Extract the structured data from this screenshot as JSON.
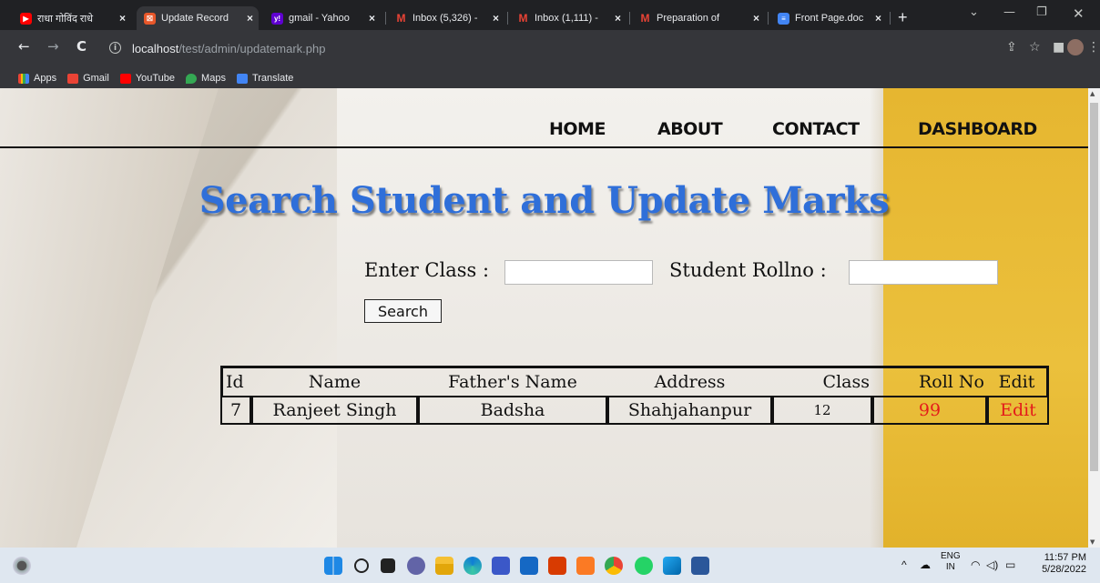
{
  "browser": {
    "tabs": [
      {
        "title": "राधा गोविंद राधे",
        "favicon_color": "#ff0000",
        "favicon": "▶",
        "active": false
      },
      {
        "title": "Update Record",
        "favicon_color": "#e8572a",
        "favicon": "☒",
        "active": true
      },
      {
        "title": "gmail - Yahoo",
        "favicon_color": "#5f01d1",
        "favicon": "y!",
        "active": false
      },
      {
        "title": "Inbox (5,326) -",
        "favicon_color": "#ea4335",
        "favicon": "M",
        "active": false
      },
      {
        "title": "Inbox (1,111) -",
        "favicon_color": "#ea4335",
        "favicon": "M",
        "active": false
      },
      {
        "title": "Preparation of",
        "favicon_color": "#ea4335",
        "favicon": "M",
        "active": false
      },
      {
        "title": "Front Page.doc",
        "favicon_color": "#4285f4",
        "favicon": "≡",
        "active": false
      }
    ],
    "url_host": "localhost",
    "url_path": "/test/admin/updatemark.php",
    "bookmarks": [
      {
        "label": "Apps",
        "color": "#4285f4"
      },
      {
        "label": "Gmail",
        "color": "#ea4335"
      },
      {
        "label": "YouTube",
        "color": "#ff0000"
      },
      {
        "label": "Maps",
        "color": "#34a853"
      },
      {
        "label": "Translate",
        "color": "#4285f4"
      }
    ]
  },
  "nav": {
    "home": "HOME",
    "about": "ABOUT",
    "contact": "CONTACT",
    "dashboard": "DASHBOARD"
  },
  "page": {
    "title": "Search Student and Update Marks",
    "class_label": "Enter Class :",
    "class_value": "",
    "rollno_label": "Student Rollno :",
    "rollno_value": "",
    "search_label": "Search"
  },
  "table": {
    "headers": [
      "Id",
      "Name",
      "Father's Name",
      "Address",
      "Class",
      "Roll No",
      "Edit"
    ],
    "rows": [
      {
        "id": "7",
        "name": "Ranjeet Singh",
        "father": "Badsha",
        "address": "Shahjahanpur",
        "class": "12",
        "rollno": "99",
        "edit": "Edit"
      }
    ]
  },
  "taskbar": {
    "lang_top": "ENG",
    "lang_bottom": "IN",
    "time": "11:57 PM",
    "date": "5/28/2022"
  }
}
